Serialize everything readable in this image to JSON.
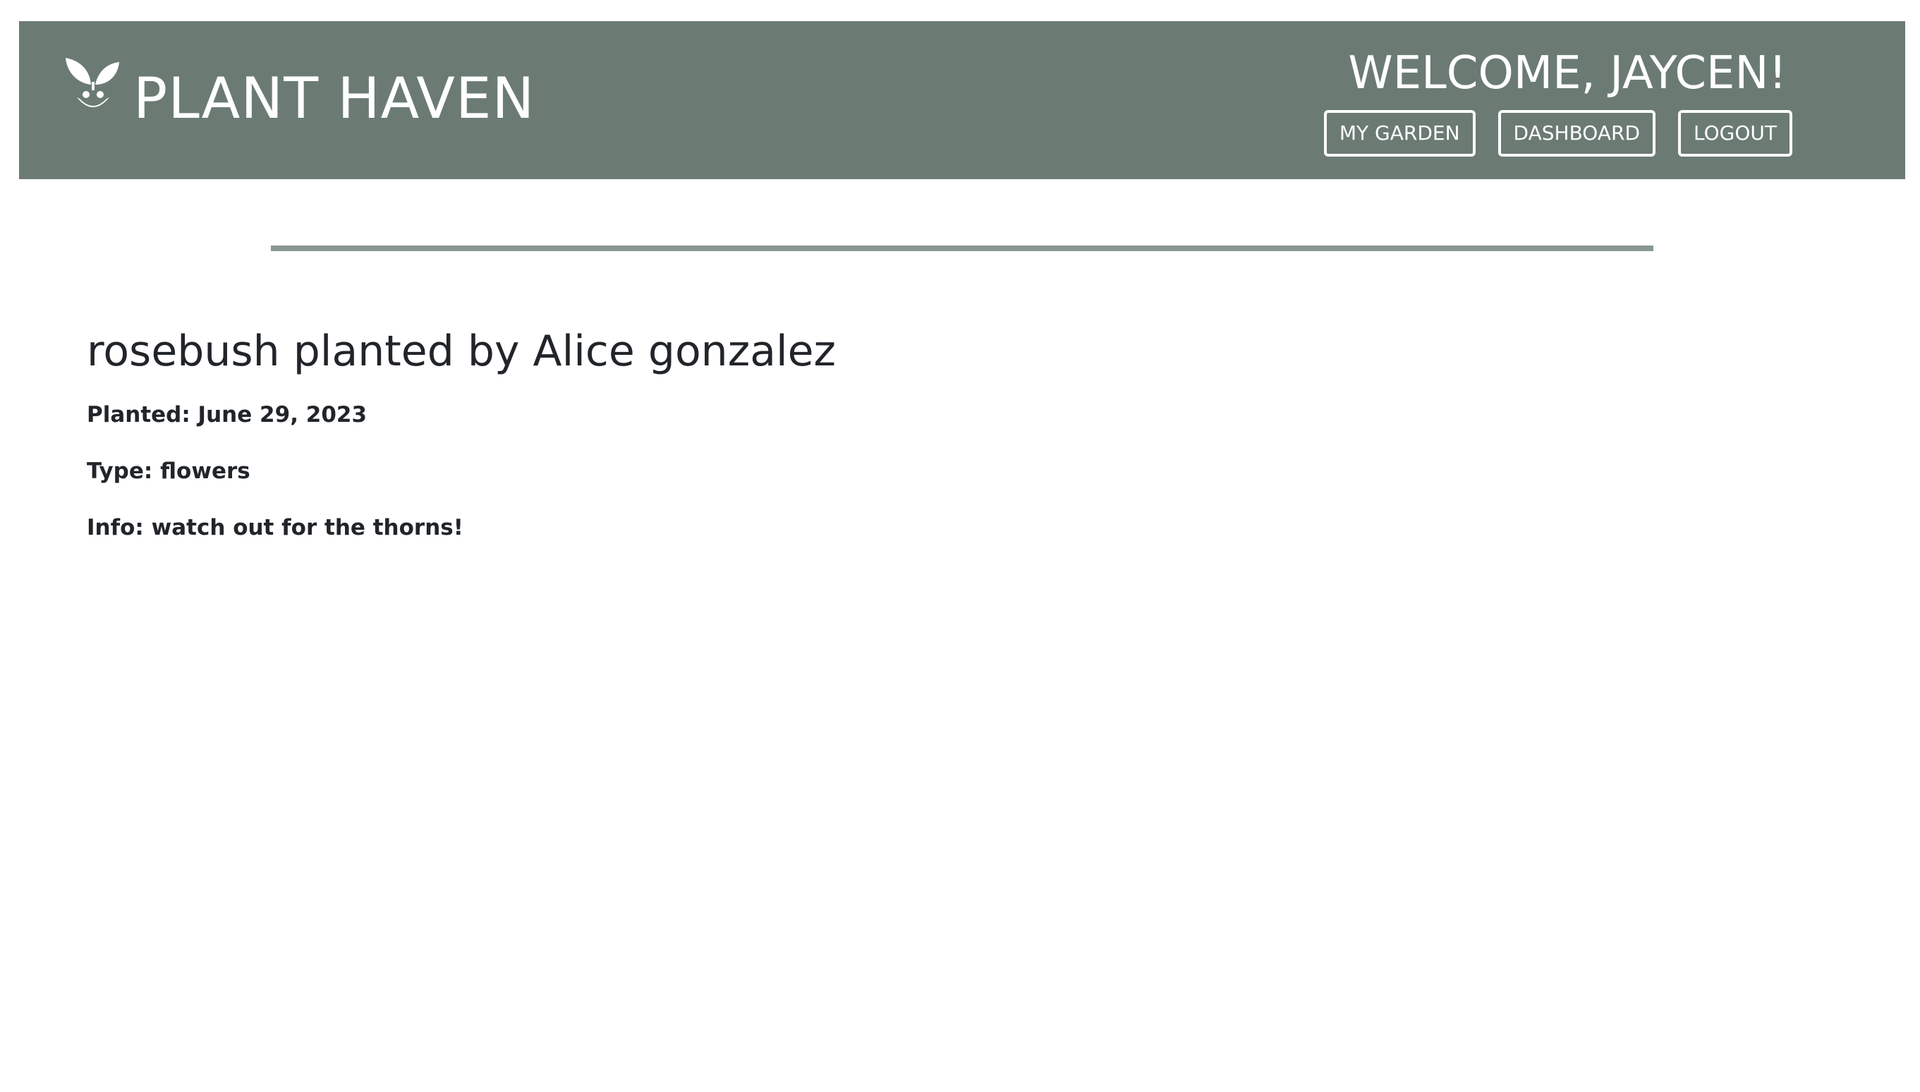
{
  "header": {
    "brand": "PLANT HAVEN",
    "logo_icon": "seedling-icon",
    "welcome": "WELCOME, JAYCEN!",
    "nav": [
      "MY GARDEN",
      "DASHBOARD",
      "LOGOUT"
    ],
    "background_color": "#6b7b74"
  },
  "plant": {
    "title": "rosebush planted by Alice gonzalez",
    "planted": "Planted: June 29, 2023",
    "type": "Type: flowers",
    "info": "Info: watch out for the thorns!"
  },
  "divider_color": "#8a9892"
}
